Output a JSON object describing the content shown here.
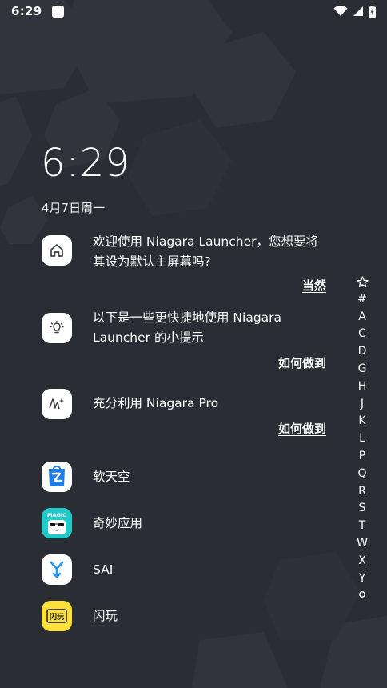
{
  "status_bar": {
    "time": "6:29",
    "icons": [
      "notification-square-icon",
      "wifi-icon",
      "signal-icon",
      "battery-charging-icon"
    ]
  },
  "clock": {
    "time": "6:29",
    "date": "4月7日周一"
  },
  "cards": [
    {
      "icon": "home-icon",
      "text": "欢迎使用 Niagara Launcher，您想要将其设为默认主屏幕吗?",
      "action": "当然"
    },
    {
      "icon": "lightbulb-icon",
      "text": "以下是一些更快捷地使用 Niagara Launcher 的小提示",
      "action": "如何做到"
    },
    {
      "icon": "niagara-pro-icon",
      "text": "充分利用 Niagara Pro",
      "action": "如何做到"
    }
  ],
  "apps": [
    {
      "name": "软天空",
      "icon": "ruantiankong-icon"
    },
    {
      "name": "奇妙应用",
      "icon": "magic-app-icon",
      "icon_badge": "MAGIC"
    },
    {
      "name": "SAI",
      "icon": "sai-icon"
    },
    {
      "name": "闪玩",
      "icon": "shanwan-icon",
      "icon_badge": "闪玩"
    }
  ],
  "alphabet_index": [
    "#",
    "A",
    "C",
    "D",
    "G",
    "H",
    "J",
    "K",
    "L",
    "P",
    "Q",
    "R",
    "S",
    "T",
    "W",
    "X",
    "Y"
  ],
  "colors": {
    "background": "#2a2d33",
    "hexagon": "#33363d",
    "icon_background": "#ffffff",
    "ruantiankong_blue": "#1f7ee6",
    "magic_teal": "#1fc7c7",
    "sai_blue": "#2196f3",
    "shanwan_yellow": "#ffe03a"
  }
}
